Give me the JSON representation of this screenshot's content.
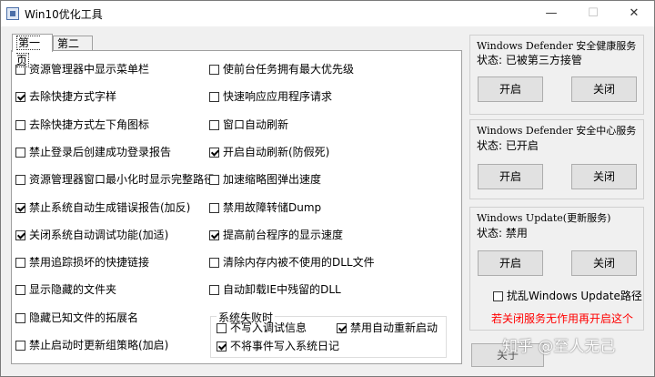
{
  "window": {
    "title": "Win10优化工具",
    "minimize": "—",
    "maximize": "☐",
    "close": "✕"
  },
  "tabs": {
    "page1": "第一页",
    "page2": "第二页"
  },
  "left_column": [
    {
      "label": "资源管理器中显示菜单栏",
      "checked": false
    },
    {
      "label": "去除快捷方式字样",
      "checked": true
    },
    {
      "label": "去除快捷方式左下角图标",
      "checked": false
    },
    {
      "label": "禁止登录后创建成功登录报告",
      "checked": false
    },
    {
      "label": "资源管理器窗口最小化时显示完整路径",
      "checked": false
    },
    {
      "label": "禁止系统自动生成错误报告(加反)",
      "checked": true
    },
    {
      "label": "关闭系统自动调试功能(加适)",
      "checked": true
    },
    {
      "label": "禁用追踪损坏的快捷链接",
      "checked": false
    },
    {
      "label": "显示隐藏的文件夹",
      "checked": false
    },
    {
      "label": "隐藏已知文件的拓展名",
      "checked": false
    },
    {
      "label": "禁止启动时更新组策略(加启)",
      "checked": false
    }
  ],
  "right_column": [
    {
      "label": "使前台任务拥有最大优先级",
      "checked": false
    },
    {
      "label": "快速响应应用程序请求",
      "checked": false
    },
    {
      "label": "窗口自动刷新",
      "checked": false
    },
    {
      "label": "开启自动刷新(防假死)",
      "checked": true
    },
    {
      "label": "加速缩略图弹出速度",
      "checked": false
    },
    {
      "label": "禁用故障转储Dump",
      "checked": false
    },
    {
      "label": "提高前台程序的显示速度",
      "checked": true
    },
    {
      "label": "清除内存内被不使用的DLL文件",
      "checked": false
    },
    {
      "label": "自动卸载IE中残留的DLL",
      "checked": false
    }
  ],
  "system_failure": {
    "title": "系统失败时",
    "options": [
      {
        "label": "不写入调试信息",
        "checked": false
      },
      {
        "label": "禁用自动重新启动",
        "checked": true
      },
      {
        "label": "不将事件写入系统日记",
        "checked": true
      }
    ]
  },
  "services": [
    {
      "name": "Windows Defender 安全健康服务",
      "status": "状态: 已被第三方接管",
      "enable": "开启",
      "disable": "关闭"
    },
    {
      "name": "Windows Defender 安全中心服务",
      "status": "状态: 已开启",
      "enable": "开启",
      "disable": "关闭"
    },
    {
      "name": "Windows Update(更新服务)",
      "status": "状态: 禁用",
      "enable": "开启",
      "disable": "关闭"
    }
  ],
  "update_path": {
    "label": "扰乱Windows Update路径",
    "checked": false
  },
  "warning": "若关闭服务无作用再开启这个",
  "bottom_button": "关于",
  "watermark": "知乎 @至人无己"
}
